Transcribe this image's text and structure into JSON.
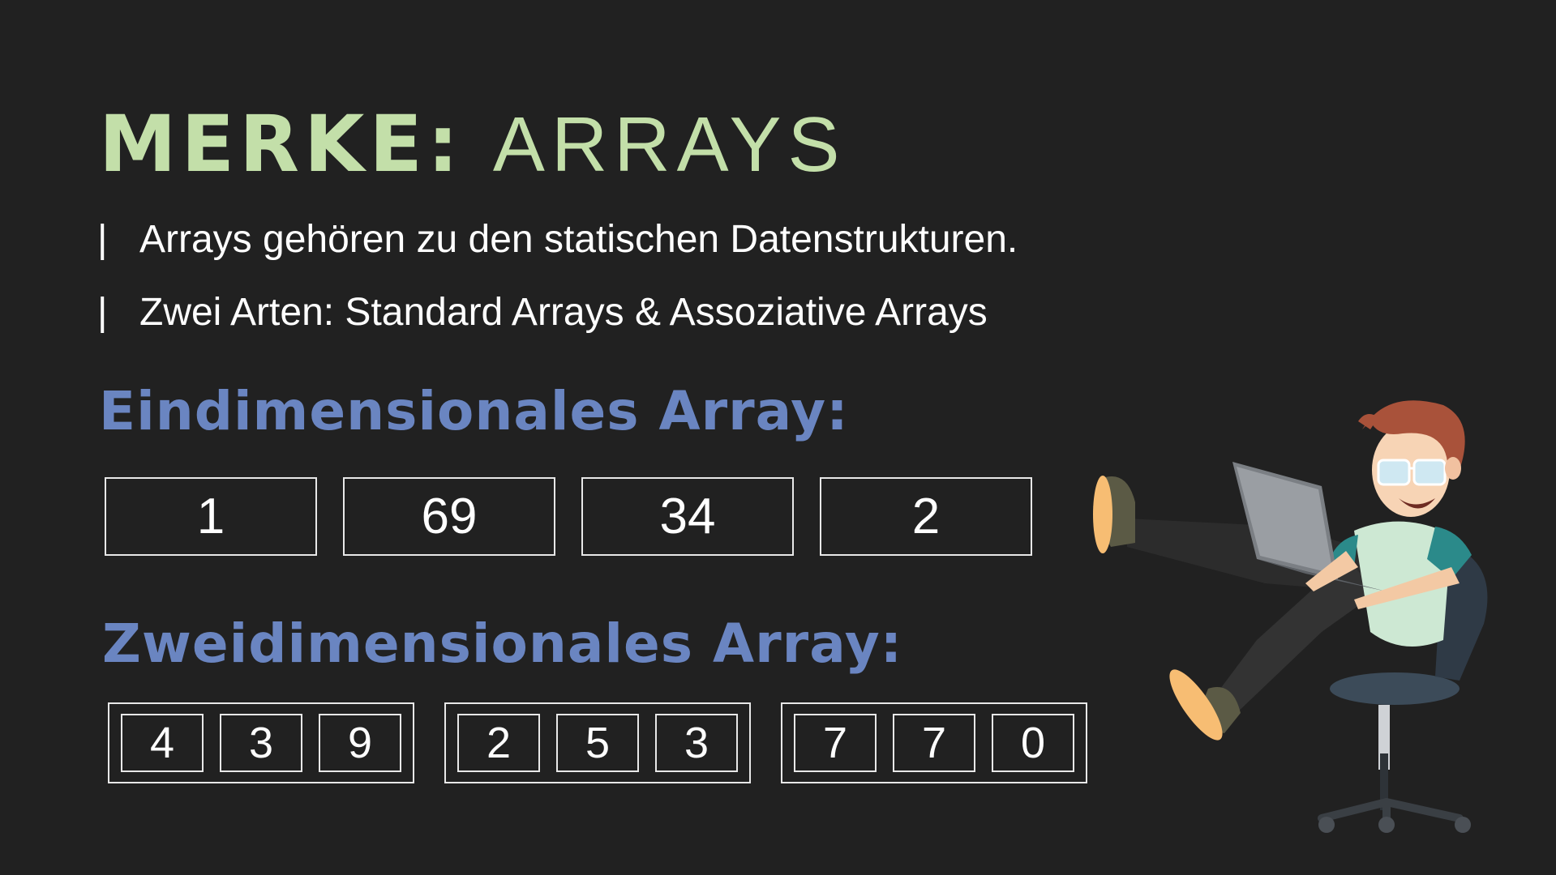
{
  "title": {
    "bold": "MERKE:",
    "light": "ARRAYS"
  },
  "bullets": [
    {
      "marker": "|",
      "text": "Arrays gehören zu den statischen Datenstrukturen."
    },
    {
      "marker": "|",
      "text": "Zwei Arten: Standard Arrays & Assoziative Arrays"
    }
  ],
  "one_dim": {
    "heading": "Eindimensionales Array:",
    "values": [
      "1",
      "69",
      "34",
      "2"
    ]
  },
  "two_dim": {
    "heading": "Zweidimensionales Array:",
    "groups": [
      [
        "4",
        "3",
        "9"
      ],
      [
        "2",
        "5",
        "3"
      ],
      [
        "7",
        "7",
        "0"
      ]
    ]
  },
  "colors": {
    "background": "#212121",
    "title": "#c3dfa9",
    "heading": "#6a85c1",
    "text": "#ffffff"
  },
  "illustration": "developer-with-laptop-on-chair"
}
